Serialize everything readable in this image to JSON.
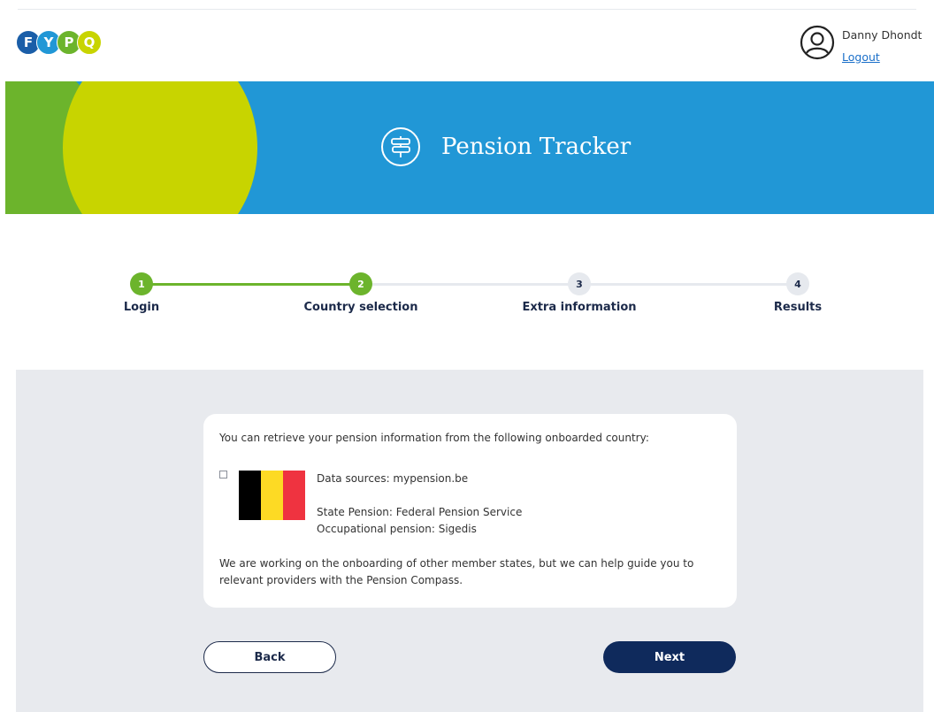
{
  "header": {
    "logo_letters": [
      "F",
      "Y",
      "P",
      "Q"
    ],
    "logo_colors": [
      "#1a5ea8",
      "#2197d6",
      "#6cb42c",
      "#c8d400"
    ],
    "user_name": "Danny Dhondt",
    "logout_label": "Logout",
    "avatar_icon": "user-circle-icon"
  },
  "banner": {
    "title": "Pension Tracker",
    "icon": "signpost-icon",
    "background": "#2197d6"
  },
  "stepper": {
    "active_color": "#6cb42c",
    "inactive_color": "#e6e9ee",
    "steps": [
      {
        "number": "1",
        "label": "Login",
        "status": "completed"
      },
      {
        "number": "2",
        "label": "Country selection",
        "status": "active"
      },
      {
        "number": "3",
        "label": "Extra information",
        "status": "pending"
      },
      {
        "number": "4",
        "label": "Results",
        "status": "pending"
      }
    ]
  },
  "card": {
    "intro": "You can retrieve your pension information from the following onboarded country:",
    "country": {
      "selected": false,
      "flag_colors": [
        "#000000",
        "#fdda24",
        "#ef3340"
      ],
      "data_sources": "Data sources: mypension.be",
      "state_pension": "State Pension: Federal Pension Service",
      "occupational_pension": "Occupational pension: Sigedis"
    },
    "outro": "We are working on the onboarding of other member states, but we can help guide you to relevant providers with the Pension Compass."
  },
  "actions": {
    "back_label": "Back",
    "next_label": "Next"
  }
}
